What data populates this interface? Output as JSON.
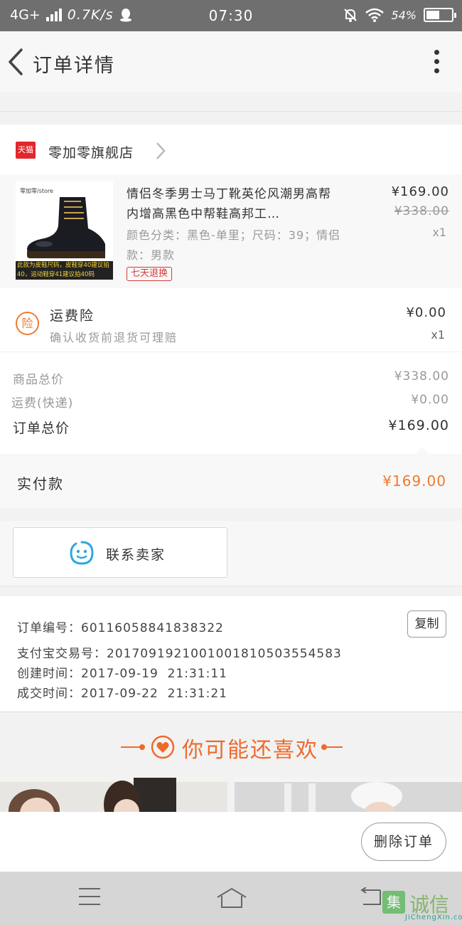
{
  "status_bar": {
    "network": "4G+",
    "speed": "0.7K/s",
    "time": "07:30",
    "battery": "54%",
    "battery_level": 0.54
  },
  "header": {
    "title": "订单详情"
  },
  "shop": {
    "badge": "天猫",
    "name": "零加零旗舰店"
  },
  "product": {
    "image_logo": "零加零/store",
    "image_note": "此款为皮鞋尺码，皮鞋穿40建议拍40，运动鞋穿41建议拍40码",
    "title": "情侣冬季男士马丁靴英伦风潮男高帮内增高黑色中帮鞋高邦工…",
    "sku": "颜色分类：黑色-单里；尺码：39；情侣款：男款",
    "tag": "七天退换",
    "price": "¥169.00",
    "original_price": "¥338.00",
    "qty": "x1"
  },
  "insurance": {
    "icon_char": "险",
    "title": "运费险",
    "desc": "确认收货前退货可理赔",
    "price": "¥0.00",
    "qty": "x1"
  },
  "totals": {
    "goods_label": "商品总价",
    "goods_value": "¥338.00",
    "shipping_label": "运费(快递)",
    "shipping_value": "¥0.00",
    "order_label": "订单总价",
    "order_value": "¥169.00"
  },
  "payment": {
    "label": "实付款",
    "value": "¥169.00"
  },
  "contact": {
    "label": "联系卖家"
  },
  "order_info": {
    "order_no_label": "订单编号：",
    "order_no": "60116058841838322",
    "alipay_label": "支付宝交易号：",
    "alipay_no": "2017091921001001810503554583",
    "created_label": "创建时间：",
    "created": "2017-09-19  21:31:11",
    "deal_label": "成交时间：",
    "deal": "2017-09-22  21:31:21",
    "copy_label": "复制"
  },
  "recommend": {
    "title": "你可能还喜欢"
  },
  "actions": {
    "delete_label": "删除订单"
  },
  "watermark": {
    "badge": "集",
    "text": "诚信",
    "sub": "JiChengXin.com"
  },
  "colors": {
    "accent": "#ef6a2c",
    "tmall": "#e3262c",
    "tag_red": "#d43a3a"
  }
}
